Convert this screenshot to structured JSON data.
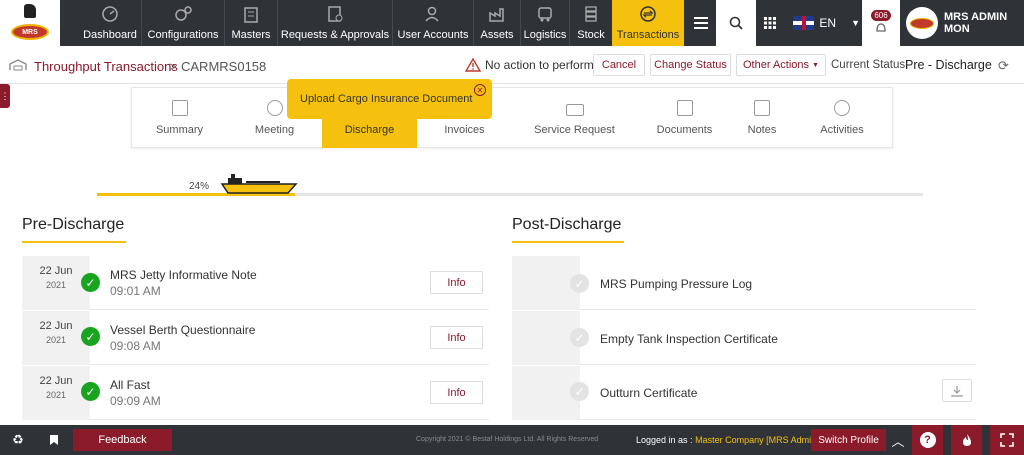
{
  "brand": {
    "logo_text": "MRS"
  },
  "nav": {
    "items": [
      {
        "label": "Dashboard",
        "icon": "dashboard-icon"
      },
      {
        "label": "Configurations",
        "icon": "gears-icon"
      },
      {
        "label": "Masters",
        "icon": "building-icon"
      },
      {
        "label": "Requests & Approvals",
        "icon": "document-check-icon"
      },
      {
        "label": "User Accounts",
        "icon": "users-icon"
      },
      {
        "label": "Assets",
        "icon": "factory-icon"
      },
      {
        "label": "Logistics",
        "icon": "truck-icon"
      },
      {
        "label": "Stock",
        "icon": "stock-icon"
      },
      {
        "label": "Transactions",
        "icon": "transactions-icon"
      }
    ],
    "language": "EN",
    "notifications_count": "606",
    "user_name": "MRS ADMIN",
    "user_role": "MON"
  },
  "breadcrumb": {
    "parent": "Throughput Transactions",
    "separator": ">",
    "current": "CARMRS0158"
  },
  "actions": {
    "warning": "No action to perform..!",
    "cancel": "Cancel",
    "change_status": "Change Status",
    "other_actions": "Other Actions",
    "status_label": "Current Status:",
    "status_value": "Pre - Discharge"
  },
  "tabs": [
    {
      "label": "Summary",
      "icon": "summary-icon"
    },
    {
      "label": "Meeting",
      "icon": "meeting-icon"
    },
    {
      "label": "Discharge",
      "icon": "ship-icon"
    },
    {
      "label": "Invoices",
      "icon": "invoice-icon"
    },
    {
      "label": "Service Request",
      "icon": "service-request-icon"
    },
    {
      "label": "Documents",
      "icon": "folder-icon"
    },
    {
      "label": "Notes",
      "icon": "notes-icon"
    },
    {
      "label": "Activities",
      "icon": "activities-icon"
    }
  ],
  "tooltip": "Upload Cargo Insurance Document",
  "progress": {
    "percent_label": "24%",
    "value": 0.24
  },
  "pre_discharge": {
    "title": "Pre-Discharge",
    "info_label": "Info",
    "rows": [
      {
        "day": "22 Jun",
        "year": "2021",
        "title": "MRS Jetty Informative Note",
        "time": "09:01 AM"
      },
      {
        "day": "22 Jun",
        "year": "2021",
        "title": "Vessel Berth Questionnaire",
        "time": "09:08 AM"
      },
      {
        "day": "22 Jun",
        "year": "2021",
        "title": "All Fast",
        "time": "09:09 AM"
      }
    ]
  },
  "post_discharge": {
    "title": "Post-Discharge",
    "rows": [
      {
        "title": "MRS Pumping Pressure Log"
      },
      {
        "title": "Empty Tank Inspection Certificate"
      },
      {
        "title": "Outturn Certificate"
      }
    ]
  },
  "footer": {
    "feedback": "Feedback",
    "copyright": "Copyright 2021 © Bestaf Holdings Ltd. All Rights Reserved",
    "logged_in_label": "Logged in as :",
    "logged_in_value": "Master Company [MRS Admin]",
    "switch_profile": "Switch Profile"
  },
  "colors": {
    "accent": "#f5c10e",
    "brand": "#8b1a2b",
    "nav_bg": "#2f3237",
    "success": "#17a51f"
  }
}
